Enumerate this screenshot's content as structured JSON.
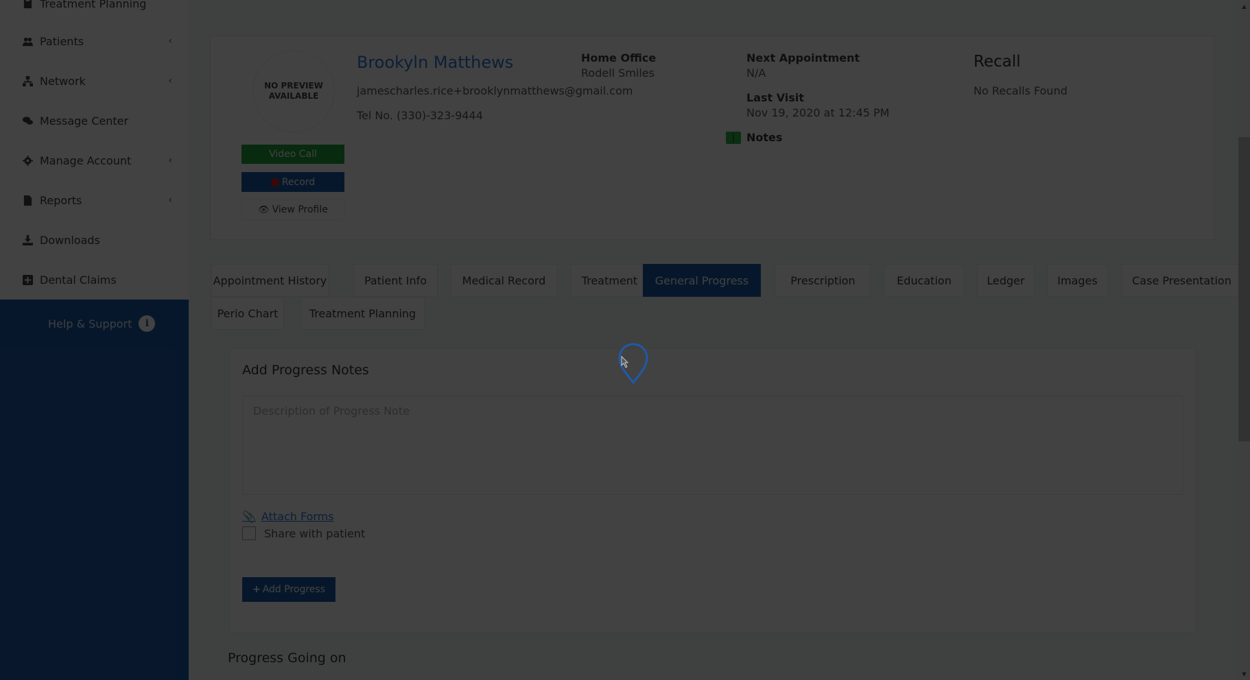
{
  "sidebar": {
    "items": [
      {
        "label": "Treatment Planning",
        "icon": "clipboard-icon",
        "has_submenu": false
      },
      {
        "label": "Patients",
        "icon": "users-icon",
        "has_submenu": true
      },
      {
        "label": "Network",
        "icon": "sitemap-icon",
        "has_submenu": true
      },
      {
        "label": "Message Center",
        "icon": "comments-icon",
        "has_submenu": false
      },
      {
        "label": "Manage Account",
        "icon": "gear-icon",
        "has_submenu": true
      },
      {
        "label": "Reports",
        "icon": "file-icon",
        "has_submenu": true
      },
      {
        "label": "Downloads",
        "icon": "download-icon",
        "has_submenu": false
      },
      {
        "label": "Dental Claims",
        "icon": "plus-square-icon",
        "has_submenu": false
      }
    ],
    "chevron": "‹",
    "help": {
      "label": "Help & Support",
      "icon": "info-icon",
      "icon_glyph": "i"
    }
  },
  "patient": {
    "avatar_text": "NO PREVIEW AVAILABLE",
    "name": "Brookyln Matthews",
    "email": "jamescharles.rice+brooklynmatthews@gmail.com",
    "tel": "Tel No. (330)-323-9444",
    "video_call_label": "Video Call",
    "record_label": "Record",
    "view_profile_label": "View Profile"
  },
  "info": {
    "home_office_label": "Home Office",
    "home_office_value": "Rodell Smiles",
    "next_appointment_label": "Next Appointment",
    "next_appointment_value": "N/A",
    "last_visit_label": "Last Visit",
    "last_visit_value": "Nov 19, 2020 at 12:45 PM",
    "notes_label": "Notes",
    "recall_title": "Recall",
    "recall_value": "No Recalls Found"
  },
  "tabs": [
    {
      "label": "Appointment History",
      "active": false
    },
    {
      "label": "Patient Info",
      "active": false
    },
    {
      "label": "Medical Record",
      "active": false
    },
    {
      "label": "Treatment",
      "active": false
    },
    {
      "label": "General Progress",
      "active": true
    },
    {
      "label": "Prescription",
      "active": false
    },
    {
      "label": "Education",
      "active": false
    },
    {
      "label": "Ledger",
      "active": false
    },
    {
      "label": "Images",
      "active": false
    },
    {
      "label": "Case Presentation",
      "active": false
    },
    {
      "label": "Perio Chart",
      "active": false
    },
    {
      "label": "Treatment Planning",
      "active": false
    }
  ],
  "progress": {
    "title": "Add Progress Notes",
    "placeholder": "Description of Progress Note",
    "attach_label": "Attach Forms",
    "share_label": "Share with patient",
    "add_button_label": "Add Progress",
    "going_on_title": "Progress Going on"
  },
  "colors": {
    "primary": "#1e5aa8",
    "green": "#1fa33a",
    "link": "#2b78d6",
    "record_dot": "#e31b1b",
    "overlay": "rgba(0,0,0,0.74)"
  }
}
